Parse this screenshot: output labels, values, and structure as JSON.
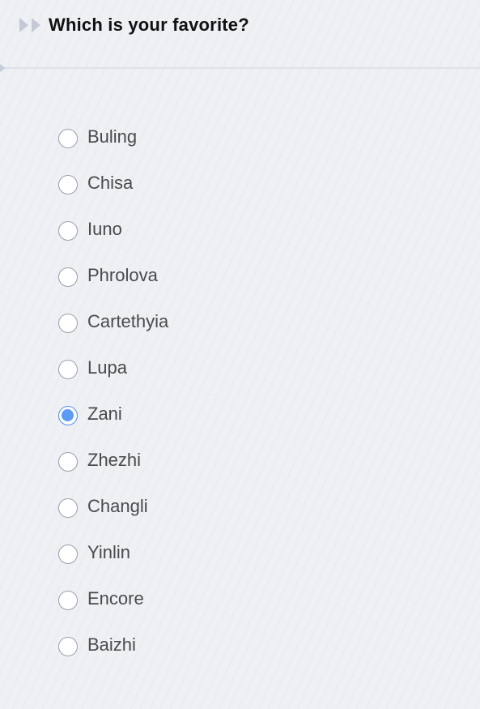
{
  "question": {
    "title": "Which is your favorite?",
    "icon": "double-chevron-right-icon"
  },
  "options": [
    {
      "label": "Buling",
      "selected": false
    },
    {
      "label": "Chisa",
      "selected": false
    },
    {
      "label": "Iuno",
      "selected": false
    },
    {
      "label": "Phrolova",
      "selected": false
    },
    {
      "label": "Cartethyia",
      "selected": false
    },
    {
      "label": "Lupa",
      "selected": false
    },
    {
      "label": "Zani",
      "selected": true
    },
    {
      "label": "Zhezhi",
      "selected": false
    },
    {
      "label": "Changli",
      "selected": false
    },
    {
      "label": "Yinlin",
      "selected": false
    },
    {
      "label": "Encore",
      "selected": false
    },
    {
      "label": "Baizhi",
      "selected": false
    }
  ],
  "colors": {
    "selected_radio": "#5b9af5",
    "background": "#eef0f4",
    "title_text": "#111111",
    "option_text": "#4a4a4a"
  }
}
